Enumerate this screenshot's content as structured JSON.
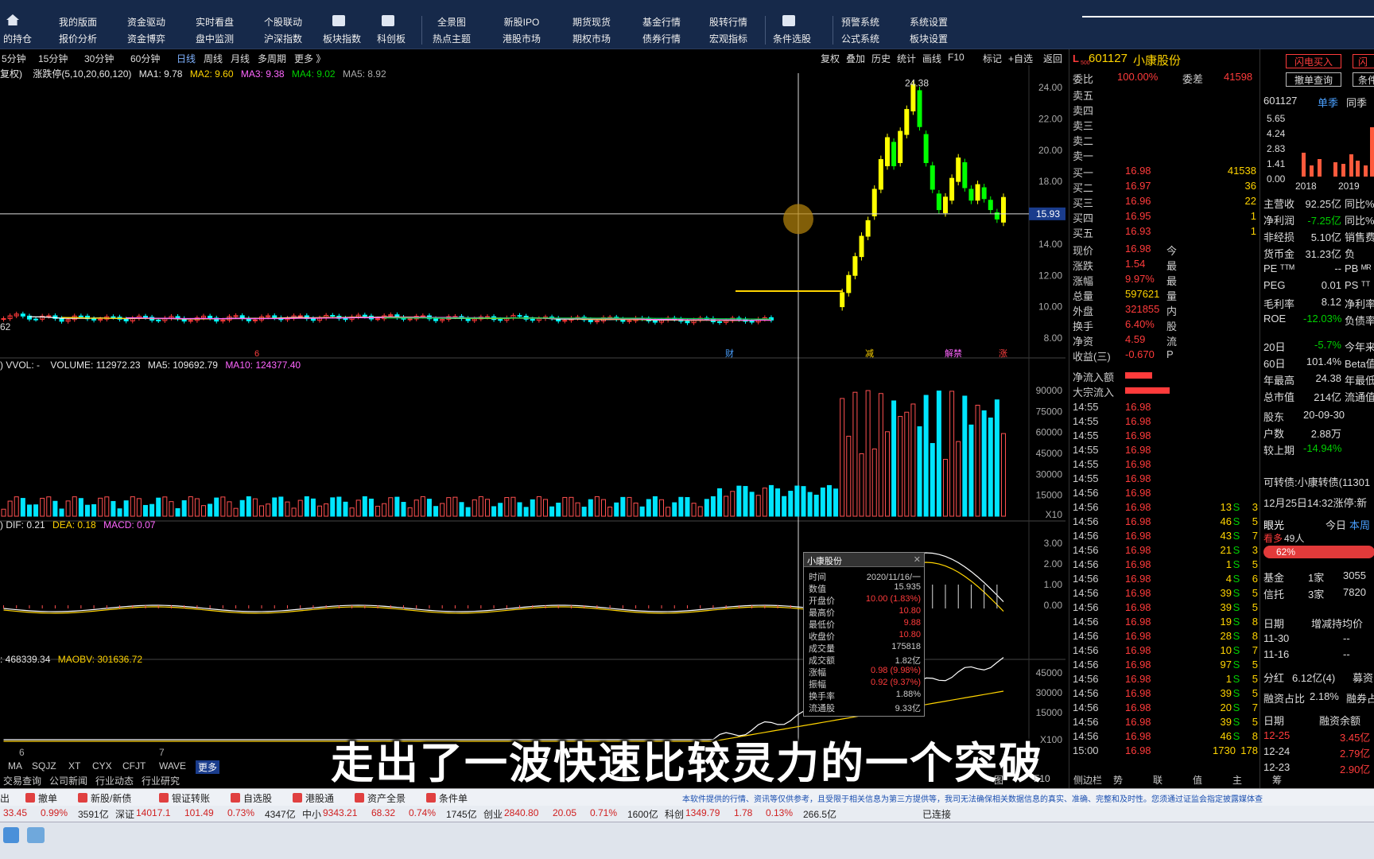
{
  "toolbar": {
    "row1": [
      "我的版面",
      "资金驱动",
      "实时看盘",
      "个股联动",
      "",
      "",
      "全景图",
      "新股IPO",
      "期货现货",
      "基金行情",
      "股转行情",
      "",
      "预警系统",
      "系统设置"
    ],
    "row2": [
      "的持仓",
      "报价分析",
      "资金博弈",
      "盘中监测",
      "沪深指数",
      "板块指数",
      "科创板",
      "热点主题",
      "港股市场",
      "期权市场",
      "债券行情",
      "宏观指标",
      "条件选股",
      "公式系统",
      "板块设置"
    ]
  },
  "periods": [
    "5分钟",
    "15分钟",
    "30分钟",
    "60分钟",
    "日线",
    "周线",
    "月线",
    "多周期",
    "更多 》"
  ],
  "chart_tools": [
    "复权",
    "叠加",
    "历史",
    "统计",
    "画线",
    "F10",
    "标记",
    "+自选",
    "返回"
  ],
  "ma_legend": {
    "prefix": "复权)",
    "name": "涨跌停(5,10,20,60,120)",
    "ma1": "MA1: 9.78",
    "ma2": "MA2: 9.60",
    "ma3": "MA3: 9.38",
    "ma4": "MA4: 9.02",
    "ma5": "MA5: 8.92"
  },
  "price_axis": [
    "24.00",
    "22.00",
    "20.00",
    "18.00",
    "16.00",
    "14.00",
    "12.00",
    "10.00",
    "8.00"
  ],
  "price_marker": "15.93",
  "peak_label": "24.38",
  "low_label": "62",
  "event_marks": [
    {
      "t": "6",
      "c": "#ff4040"
    },
    {
      "t": "财",
      "c": "#4aa0ff"
    },
    {
      "t": "减",
      "c": "#ffd400"
    },
    {
      "t": "解禁",
      "c": "#ff66ff"
    },
    {
      "t": "涨",
      "c": "#ff4040"
    }
  ],
  "vol_legend": {
    "prefix": ") VVOL: -",
    "volume": "VOLUME: 112972.23",
    "ma5": "MA5: 109692.79",
    "ma10": "MA10: 124377.40"
  },
  "vol_axis": [
    "90000",
    "75000",
    "60000",
    "45000",
    "30000",
    "15000",
    "X10"
  ],
  "macd_legend": {
    "prefix": ") DIF: 0.21",
    "dea": "DEA: 0.18",
    "macd": "MACD: 0.07"
  },
  "macd_axis": [
    "3.00",
    "2.00",
    "1.00",
    "0.00"
  ],
  "obv_legend": {
    "prefix": ": 468339.34",
    "maobv": "MAOBV: 301636.72"
  },
  "obv_axis": [
    "45000",
    "30000",
    "15000",
    "X100"
  ],
  "dates": [
    "6",
    "7",
    "0"
  ],
  "tooltip": {
    "title": "小康股份",
    "rows": [
      [
        "时间",
        "2020/11/16/一"
      ],
      [
        "数值",
        "15.935"
      ],
      [
        "开盘价",
        "10.00 (1.83%)"
      ],
      [
        "最高价",
        "10.80"
      ],
      [
        "最低价",
        "9.88"
      ],
      [
        "收盘价",
        "10.80"
      ],
      [
        "成交量",
        "175818"
      ],
      [
        "成交额",
        "1.82亿"
      ],
      [
        "涨幅",
        "0.98 (9.98%)"
      ],
      [
        "振幅",
        "0.92 (9.37%)"
      ],
      [
        "换手率",
        "1.88%"
      ],
      [
        "流通股",
        "9.33亿"
      ]
    ]
  },
  "stock": {
    "code": "601127",
    "name": "小康股份",
    "flag": "L",
    "sub": "500",
    "weibi_label": "委比",
    "weibi": "100.00%",
    "weicha_label": "委差",
    "weicha": "41598"
  },
  "sells": [
    "卖五",
    "卖四",
    "卖三",
    "卖二",
    "卖一"
  ],
  "buys": [
    [
      "买一",
      "16.98",
      "41538"
    ],
    [
      "买二",
      "16.97",
      "36"
    ],
    [
      "买三",
      "16.96",
      "22"
    ],
    [
      "买四",
      "16.95",
      "1"
    ],
    [
      "买五",
      "16.93",
      "1"
    ]
  ],
  "quote": [
    [
      "现价",
      "16.98",
      "今"
    ],
    [
      "涨跌",
      "1.54",
      "最"
    ],
    [
      "涨幅",
      "9.97%",
      "最"
    ],
    [
      "总量",
      "597621",
      "量"
    ],
    [
      "外盘",
      "321855",
      "内"
    ],
    [
      "换手",
      "6.40%",
      "股"
    ],
    [
      "净资",
      "4.59",
      "流"
    ],
    [
      "收益(三)",
      "-0.670",
      "P"
    ]
  ],
  "flow": [
    [
      "净流入额"
    ],
    [
      "大宗流入"
    ]
  ],
  "ticks": [
    [
      "14:55",
      "16.98",
      ""
    ],
    [
      "14:55",
      "16.98",
      ""
    ],
    [
      "14:55",
      "16.98",
      ""
    ],
    [
      "14:55",
      "16.98",
      ""
    ],
    [
      "14:55",
      "16.98",
      ""
    ],
    [
      "14:55",
      "16.98",
      ""
    ],
    [
      "14:56",
      "16.98",
      ""
    ],
    [
      "14:56",
      "16.98",
      "13"
    ],
    [
      "14:56",
      "16.98",
      "46"
    ],
    [
      "14:56",
      "16.98",
      "43"
    ],
    [
      "14:56",
      "16.98",
      "21"
    ],
    [
      "14:56",
      "16.98",
      "1"
    ],
    [
      "14:56",
      "16.98",
      "4"
    ],
    [
      "14:56",
      "16.98",
      "39"
    ],
    [
      "14:56",
      "16.98",
      "39"
    ],
    [
      "14:56",
      "16.98",
      "19"
    ],
    [
      "14:56",
      "16.98",
      "28"
    ],
    [
      "14:56",
      "16.98",
      "10"
    ],
    [
      "14:56",
      "16.98",
      "97"
    ],
    [
      "14:56",
      "16.98",
      "1"
    ],
    [
      "14:56",
      "16.98",
      "39"
    ],
    [
      "14:56",
      "16.98",
      "20"
    ],
    [
      "14:56",
      "16.98",
      "39"
    ],
    [
      "14:56",
      "16.98",
      "46"
    ],
    [
      "15:00",
      "16.98",
      "1730"
    ]
  ],
  "tick_tail": [
    "3",
    "5",
    "7",
    "3",
    "5",
    "6",
    "5",
    "5",
    "8",
    "8",
    "7",
    "5",
    "5",
    "5",
    "7",
    "5",
    "8",
    "178"
  ],
  "f10": {
    "buttons": [
      "闪电买入",
      "撤单查询"
    ],
    "right_buttons": [
      "闪",
      "条件"
    ],
    "code": "601127",
    "tabs": [
      "单季",
      "同季"
    ],
    "yaxis": [
      "5.65",
      "4.24",
      "2.83",
      "1.41",
      "0.00"
    ],
    "years": [
      "2018",
      "2019"
    ],
    "stats": [
      [
        "主营收",
        "92.25亿",
        "同比%"
      ],
      [
        "净利润",
        "-7.25亿",
        "同比%"
      ],
      [
        "非经损",
        "5.10亿",
        "销售费"
      ],
      [
        "货币金",
        "31.23亿",
        "负"
      ],
      [
        "PE ᵀᵀᴹ",
        "--",
        "PB ᴹᴿ"
      ],
      [
        "PEG",
        "0.01",
        "PS ᵀᵀ"
      ],
      [
        "毛利率",
        "8.12",
        "净利率"
      ],
      [
        "ROE",
        "-12.03%",
        "负债率"
      ],
      [
        "20日",
        "-5.7%",
        "今年来"
      ],
      [
        "60日",
        "101.4%",
        "Beta值"
      ],
      [
        "年最高",
        "24.38",
        "年最低"
      ],
      [
        "总市值",
        "214亿",
        "流通值"
      ],
      [
        "股东",
        "20-09-30",
        ""
      ],
      [
        "户数",
        "2.88万",
        ""
      ],
      [
        "较上期",
        "-14.94%",
        ""
      ]
    ],
    "convert": "可转债:小康转债(11301",
    "news": "12月25日14:32涨停:新",
    "eye": "眼光",
    "today": "今日",
    "week": "本周",
    "bull": "看多",
    "bull_n": "49人",
    "pct": "62%",
    "funds": [
      [
        "基金",
        "1家",
        "3055"
      ],
      [
        "信托",
        "3家",
        "7820"
      ]
    ],
    "change_hdr": [
      "日期",
      "增减持均价"
    ],
    "changes": [
      [
        "11-30",
        "--"
      ],
      [
        "11-16",
        "--"
      ]
    ],
    "dividend": [
      "分红",
      "6.12亿(4)",
      "募资"
    ],
    "margin": [
      "融资占比",
      "2.18%",
      "融券占"
    ],
    "margin_hdr": [
      "日期",
      "融资余额"
    ],
    "margins": [
      [
        "12-25",
        "3.45亿"
      ],
      [
        "12-24",
        "2.79亿"
      ],
      [
        "12-23",
        "2.90亿"
      ]
    ]
  },
  "bottom_tabs": [
    "MA",
    "SQJZ",
    "XT",
    "CYX",
    "CFJT",
    "WAVE",
    "更多"
  ],
  "bottom_tabs2": [
    "交易查询",
    "公司新闻",
    "行业动态",
    "行业研究"
  ],
  "right_tabs": [
    "图",
    "F10",
    "侧边栏",
    "势",
    "联",
    "值",
    "主",
    "筹"
  ],
  "subtitle": "走出了一波快速比较灵力的一个突破",
  "shortcuts": [
    "撤单",
    "新股/新债",
    "银证转账",
    "自选股",
    "港股通",
    "资产全景",
    "条件单"
  ],
  "disclaimer": "本软件提供的行情、资讯等仅供参考，且受限于相关信息为第三方提供等，我司无法确保相关数据信息的真实、准确、完整和及时性。您须通过证监会指定披露媒体查",
  "ticker": [
    [
      "33.45",
      "0.99%",
      "3591亿"
    ],
    [
      "深证",
      "14017.1",
      "101.49",
      "0.73%",
      "4347亿"
    ],
    [
      "中小",
      "9343.21",
      "68.32",
      "0.74%",
      "1745亿"
    ],
    [
      "创业",
      "2840.80",
      "20.05",
      "0.71%",
      "1600亿"
    ],
    [
      "科创",
      "1349.79",
      "1.78",
      "0.13%",
      "266.5亿"
    ]
  ],
  "connect": "已连接",
  "colors": {
    "up": "#ff3b3b",
    "down": "#00ffff",
    "ma1": "#ffffff",
    "ma2": "#ffd400",
    "ma3": "#ff66ff",
    "ma4": "#00cc44",
    "ma5": "#aaaaaa",
    "bg": "#000000",
    "toolbar": "#16294a"
  }
}
